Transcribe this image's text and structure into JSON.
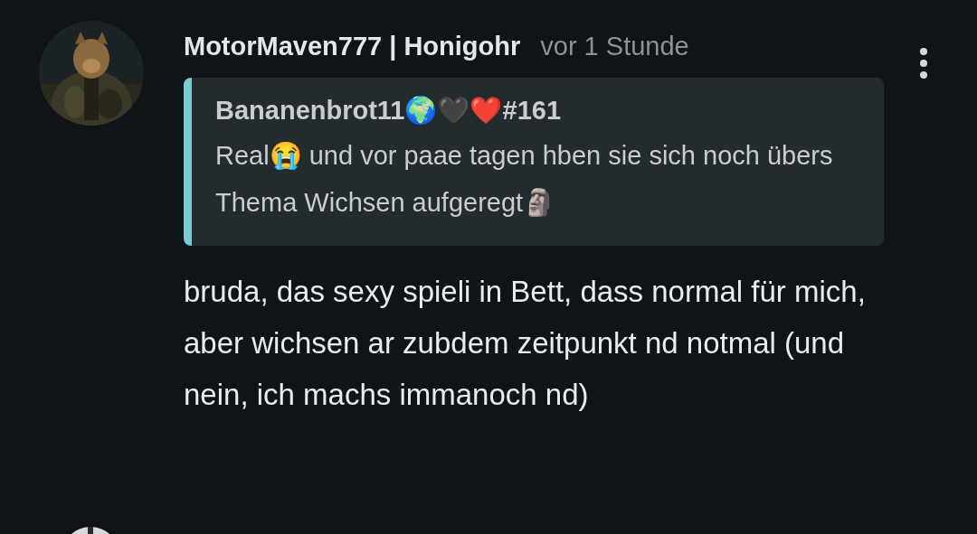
{
  "comment": {
    "author": "MotorMaven777 | Honigohr",
    "time": "vor 1 Stunde",
    "quote": {
      "author": "Bananenbrot11🌍🖤❤️#161",
      "text": "Real😭 und vor paae tagen hben sie sich noch übers Thema Wichsen aufgeregt🗿"
    },
    "text": "bruda, das sexy spieli in Bett, dass normal für mich, aber wichsen ar zubdem zeitpunkt nd notmal (und nein, ich machs immanoch nd)"
  }
}
